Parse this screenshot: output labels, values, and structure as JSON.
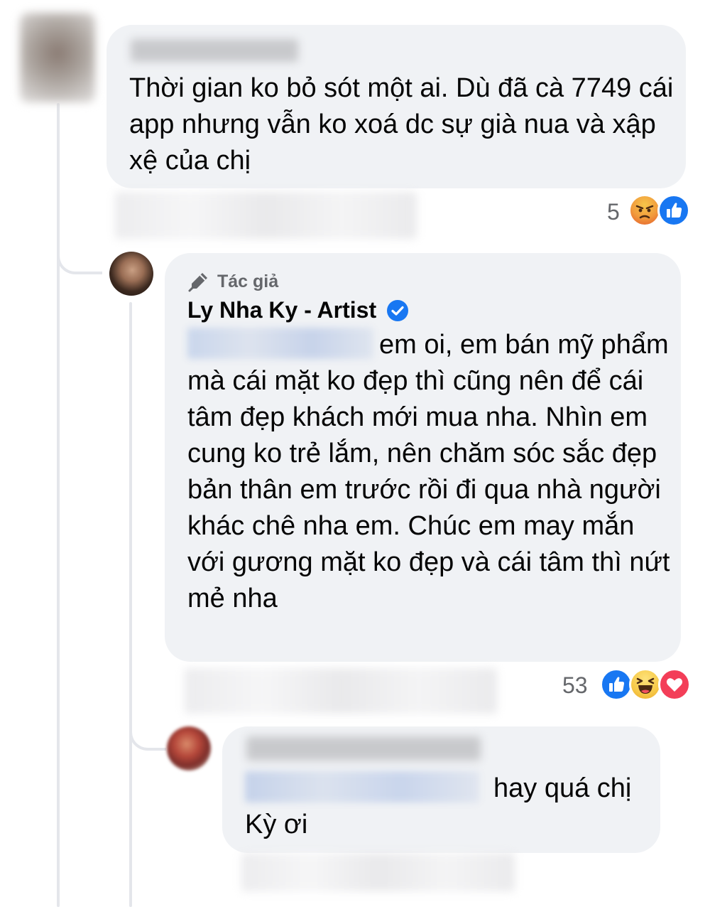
{
  "comments": [
    {
      "author": "",
      "text": "Thời gian ko bỏ sót một ai. Dù đã cà 7749 cái app nhưng vẫn ko xoá dc sự già nua và xập xệ của chị",
      "reaction_count": "5",
      "reactions": [
        "angry-icon",
        "like-icon"
      ]
    },
    {
      "badge": "Tác giả",
      "author": "Ly Nha Ky - Artist",
      "verified": true,
      "text": "em oi, em bán mỹ phẩm mà cái mặt ko đẹp thì cũng nên để cái tâm đẹp khách mới mua nha. Nhìn em cung ko trẻ lắm, nên chăm sóc sắc đẹp bản thân em trước rồi đi qua nhà người khác chê nha em. Chúc em may mắn với gương mặt ko đẹp và cái tâm thì nứt mẻ nha",
      "reaction_count": "53",
      "reactions": [
        "like-icon",
        "haha-icon",
        "love-icon"
      ]
    },
    {
      "author": "",
      "text_line1": "hay quá chị",
      "text_line2": "Kỳ ơi"
    }
  ],
  "colors": {
    "bubble": "#f0f2f5",
    "thread_line": "#e4e6eb",
    "like_blue": "#1877f2",
    "love_red": "#f33e58",
    "secondary_text": "#65676b"
  }
}
